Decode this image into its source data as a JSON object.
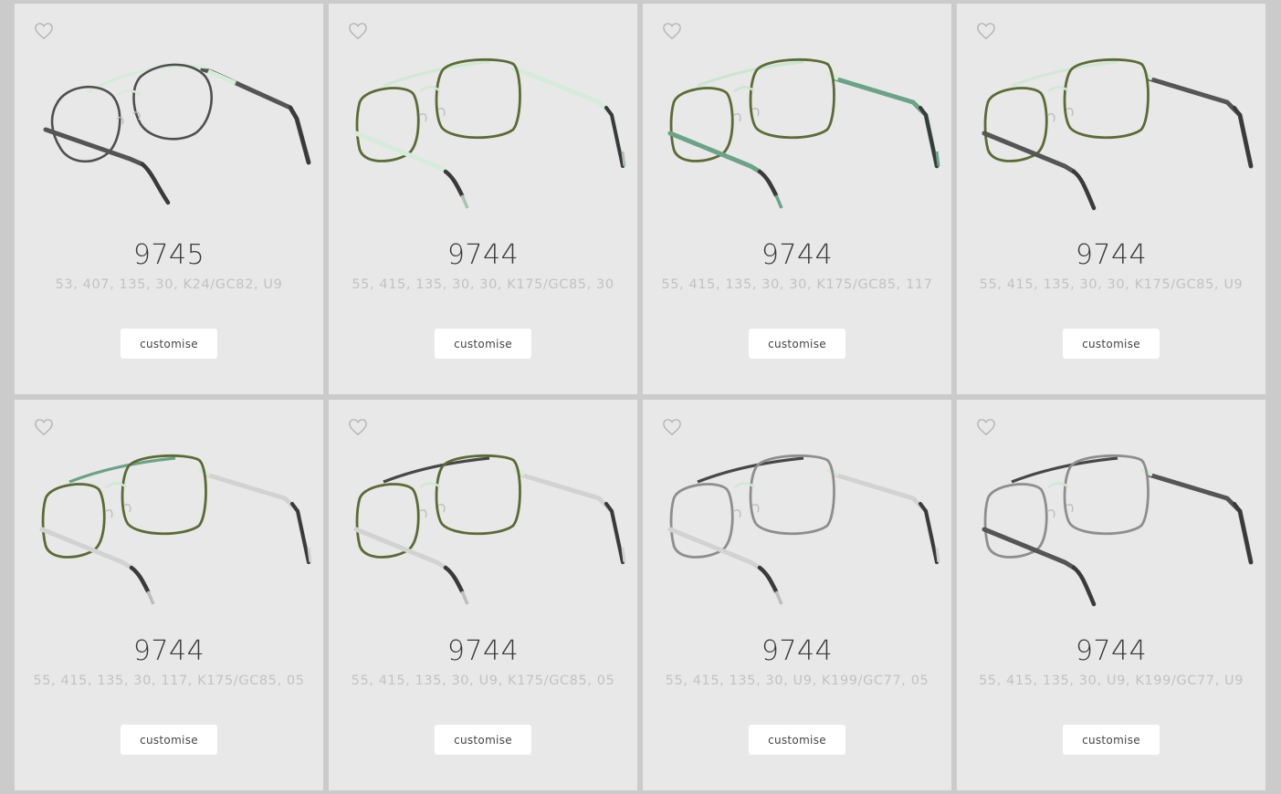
{
  "products": [
    {
      "model": "9745",
      "spec": "53, 407, 135, 30, K24/GC82, U9",
      "button_label": "customise",
      "colors": {
        "rim": "#4f4f4f",
        "bridge": "#d4ecd8",
        "temple": "#545454",
        "tip": "#3a3a3a"
      }
    },
    {
      "model": "9744",
      "spec": "55, 415, 135, 30, 30, K175/GC85, 30",
      "button_label": "customise",
      "colors": {
        "rim": "#5b6b34",
        "bridge": "#cfe9d3",
        "temple": "#d6ecda",
        "tip": "#3a3a3a"
      }
    },
    {
      "model": "9744",
      "spec": "55, 415, 135, 30, 30, K175/GC85, 117",
      "button_label": "customise",
      "colors": {
        "rim": "#5b6b34",
        "bridge": "#c9e6cf",
        "temple": "#6aa386",
        "tip": "#3a3a3a"
      }
    },
    {
      "model": "9744",
      "spec": "55, 415, 135, 30, 30, K175/GC85, U9",
      "button_label": "customise",
      "colors": {
        "rim": "#5b6b34",
        "bridge": "#cfe9d3",
        "temple": "#555555",
        "tip": "#3a3a3a"
      }
    },
    {
      "model": "9744",
      "spec": "55, 415, 135, 30, 117, K175/GC85, 05",
      "button_label": "customise",
      "colors": {
        "rim": "#5b6b34",
        "bridge": "#6aa386",
        "temple": "#d2d2d2",
        "tip": "#3a3a3a"
      }
    },
    {
      "model": "9744",
      "spec": "55, 415, 135, 30, U9, K175/GC85, 05",
      "button_label": "customise",
      "colors": {
        "rim": "#5b6b34",
        "bridge": "#474747",
        "temple": "#d2d2d2",
        "tip": "#3a3a3a"
      }
    },
    {
      "model": "9744",
      "spec": "55, 415, 135, 30, U9, K199/GC77, 05",
      "button_label": "customise",
      "colors": {
        "rim": "#8e8e8e",
        "bridge": "#474747",
        "temple": "#d2d2d2",
        "tip": "#3a3a3a"
      }
    },
    {
      "model": "9744",
      "spec": "55, 415, 135, 30, U9, K199/GC77, U9",
      "button_label": "customise",
      "colors": {
        "rim": "#8e8e8e",
        "bridge": "#474747",
        "temple": "#555555",
        "tip": "#3a3a3a"
      }
    }
  ],
  "icons": {
    "favorite": "heart-outline-icon"
  }
}
